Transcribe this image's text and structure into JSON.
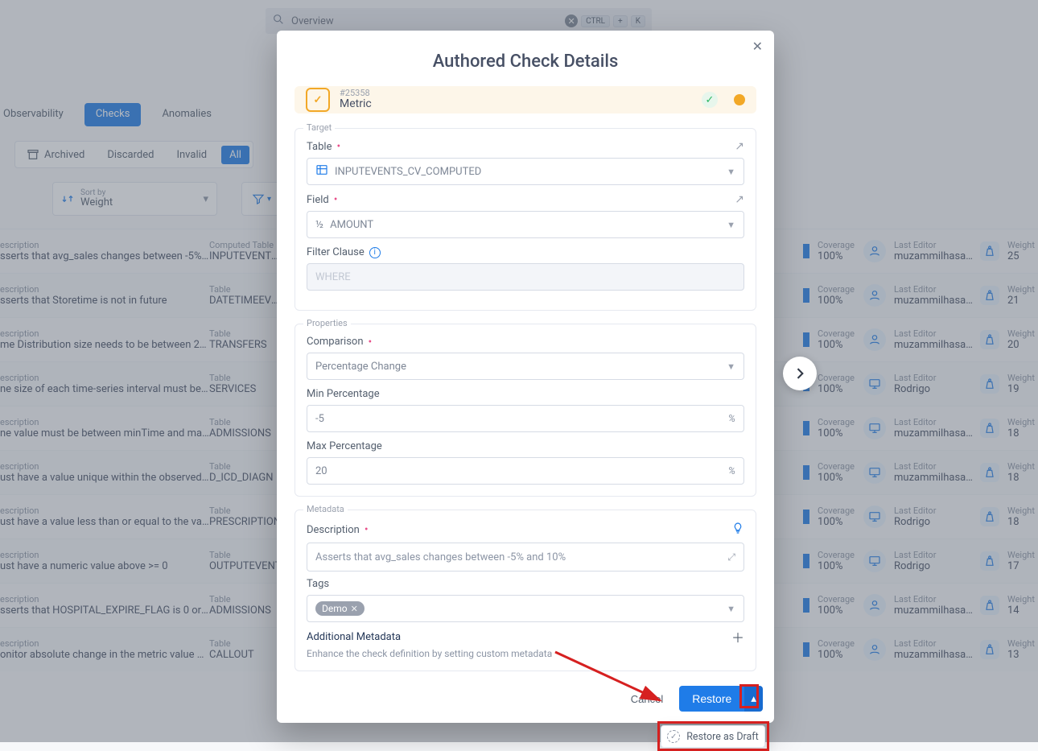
{
  "search": {
    "placeholder": "Overview",
    "shortcut1": "CTRL",
    "shortcut2": "K"
  },
  "tabs": {
    "t1": "Observability",
    "t2": "Checks",
    "t3": "Anomalies"
  },
  "filters": {
    "archived": "Archived",
    "discarded": "Discarded",
    "invalid": "Invalid",
    "all": "All"
  },
  "sort": {
    "label": "Sort by",
    "value": "Weight"
  },
  "rows": [
    {
      "descLabel": "escription",
      "desc": "sserts that avg_sales changes between -5% …",
      "tableLabel": "Computed Table",
      "table": "INPUTEVENTS_",
      "cov": "100%",
      "editor": "muzammilhasa…",
      "editorIcon": "person",
      "weight": "25"
    },
    {
      "descLabel": "escription",
      "desc": "sserts that Storetime is not in future",
      "tableLabel": "Table",
      "table": "DATETIMEEVEN",
      "cov": "100%",
      "editor": "muzammilhasa…",
      "editorIcon": "person",
      "weight": "21"
    },
    {
      "descLabel": "escription",
      "desc": "me Distribution size needs to be between 20…",
      "tableLabel": "Table",
      "table": "TRANSFERS",
      "cov": "100%",
      "editor": "muzammilhasa…",
      "editorIcon": "person",
      "weight": "20"
    },
    {
      "descLabel": "escription",
      "desc": "ne size of each time-series interval must be b…",
      "tableLabel": "Table",
      "table": "SERVICES",
      "cov": "100%",
      "editor": "Rodrigo",
      "editorIcon": "monitor",
      "weight": "19"
    },
    {
      "descLabel": "escription",
      "desc": "ne value must be between minTime and max…",
      "tableLabel": "Table",
      "table": "ADMISSIONS",
      "cov": "100%",
      "editor": "muzammilhasa…",
      "editorIcon": "monitor",
      "weight": "18"
    },
    {
      "descLabel": "escription",
      "desc": "ust have a value unique within the observed …",
      "tableLabel": "Table",
      "table": "D_ICD_DIAGN",
      "cov": "100%",
      "editor": "muzammilhasa…",
      "editorIcon": "monitor",
      "weight": "18"
    },
    {
      "descLabel": "escription",
      "desc": "ust have a value less than or equal to the val…",
      "tableLabel": "Table",
      "table": "PRESCRIPTION",
      "cov": "100%",
      "editor": "Rodrigo",
      "editorIcon": "monitor",
      "weight": "18"
    },
    {
      "descLabel": "escription",
      "desc": "ust have a numeric value above >= 0",
      "tableLabel": "Table",
      "table": "OUTPUTEVENT",
      "cov": "100%",
      "editor": "Rodrigo",
      "editorIcon": "monitor",
      "weight": "17"
    },
    {
      "descLabel": "escription",
      "desc": "sserts that HOSPITAL_EXPIRE_FLAG is 0 or 1",
      "tableLabel": "Table",
      "table": "ADMISSIONS",
      "cov": "100%",
      "editor": "muzammilhasa…",
      "editorIcon": "person",
      "weight": "14"
    },
    {
      "descLabel": "escription",
      "desc": "onitor absolute change in the metric value w…",
      "tableLabel": "Table",
      "table": "CALLOUT",
      "cov": "100%",
      "editor": "muzammilhasa…",
      "editorIcon": "person",
      "weight": "13"
    }
  ],
  "headers": {
    "coverage": "Coverage",
    "lastEditor": "Last Editor",
    "weight": "Weight"
  },
  "modal": {
    "title": "Authored Check Details",
    "id": "#25358",
    "name": "Metric",
    "target": {
      "legend": "Target",
      "tableLabel": "Table",
      "tableValue": "INPUTEVENTS_CV_COMPUTED",
      "fieldLabel": "Field",
      "fieldValue": "AMOUNT",
      "filterLabel": "Filter Clause",
      "filterPlaceholder": "WHERE"
    },
    "props": {
      "legend": "Properties",
      "comparisonLabel": "Comparison",
      "comparisonValue": "Percentage Change",
      "minLabel": "Min Percentage",
      "minValue": "-5",
      "maxLabel": "Max Percentage",
      "maxValue": "20"
    },
    "meta": {
      "legend": "Metadata",
      "descLabel": "Description",
      "descValue": "Asserts that avg_sales changes between -5% and 10%",
      "tagsLabel": "Tags",
      "tag": "Demo",
      "addLabel": "Additional Metadata",
      "addSub": "Enhance the check definition by setting custom metadata"
    },
    "footer": {
      "cancel": "Cancel",
      "restore": "Restore",
      "restoreDraft": "Restore as Draft"
    }
  }
}
